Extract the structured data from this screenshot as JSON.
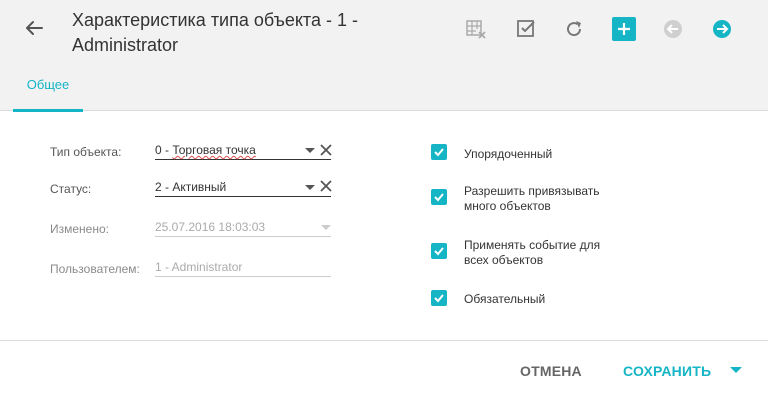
{
  "header": {
    "title": "Характеристика типа объекта - 1 - Administrator",
    "toolbar_icons": [
      "cancel-table-icon",
      "check-icon",
      "refresh-icon",
      "add-icon",
      "arrow-left-circle-icon",
      "arrow-right-circle-icon"
    ]
  },
  "tabs": [
    {
      "label": "Общее",
      "active": true
    }
  ],
  "form": {
    "object_type": {
      "label": "Тип объекта:",
      "value_prefix": "0",
      "value_sep": " - ",
      "value_text": "Торговая точка"
    },
    "status": {
      "label": "Статус:",
      "value": "2 - Активный"
    },
    "modified": {
      "label": "Изменено:",
      "value": "25.07.2016 18:03:03"
    },
    "user": {
      "label": "Пользователем:",
      "value": "1 - Administrator"
    }
  },
  "checkboxes": [
    {
      "label": "Упорядоченный",
      "checked": true
    },
    {
      "label": "Разрешить привязывать много объектов",
      "checked": true
    },
    {
      "label": "Применять событие для всех объектов",
      "checked": true
    },
    {
      "label": "Обязательный",
      "checked": true
    }
  ],
  "footer": {
    "cancel_label": "ОТМЕНА",
    "save_label": "СОХРАНИТЬ"
  },
  "colors": {
    "accent": "#16b5c6",
    "header_bg": "#f2f2f2"
  }
}
